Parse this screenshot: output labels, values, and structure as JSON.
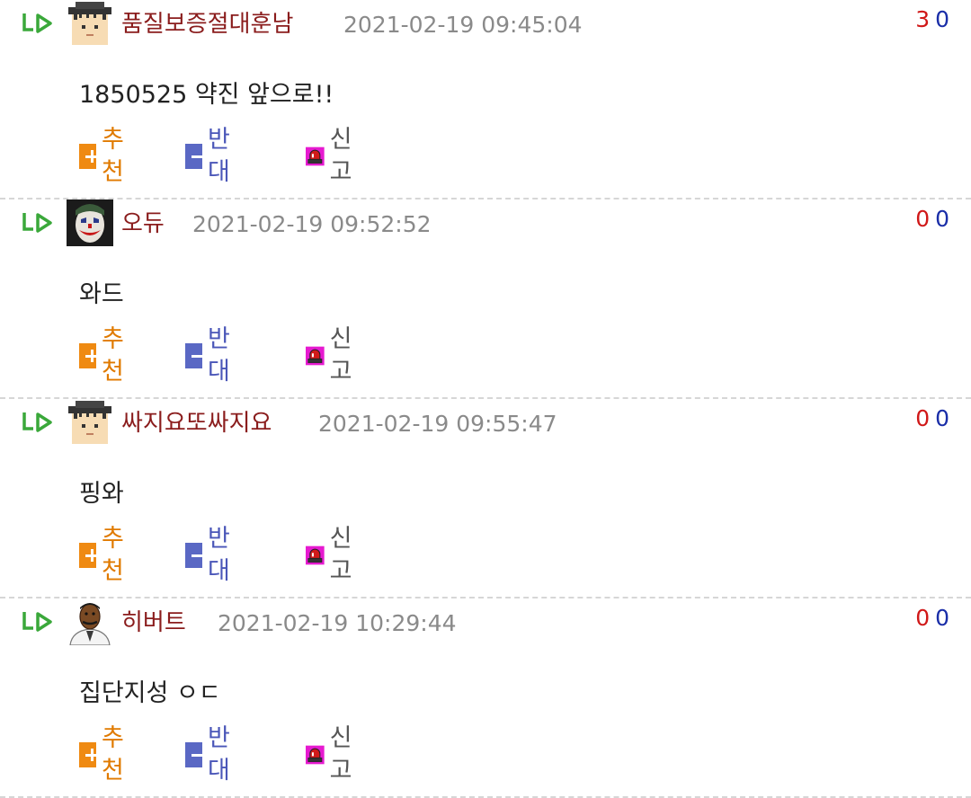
{
  "comments": [
    {
      "avatar": "graduate-cap-avatar",
      "nickname": "품질보증절대훈남",
      "date": "2021-02-19 09:45:04",
      "upvotes": "3",
      "downvotes": "0",
      "text": "1850525 약진 앞으로!!"
    },
    {
      "avatar": "joker-avatar",
      "nickname": "오듀",
      "date": "2021-02-19 09:52:52",
      "upvotes": "0",
      "downvotes": "0",
      "text": "와드"
    },
    {
      "avatar": "graduate-cap-avatar",
      "nickname": "싸지요또싸지요",
      "date": "2021-02-19 09:55:47",
      "upvotes": "0",
      "downvotes": "0",
      "text": "핑와"
    },
    {
      "avatar": "doctor-avatar",
      "nickname": "히버트",
      "date": "2021-02-19 10:29:44",
      "upvotes": "0",
      "downvotes": "0",
      "text": "집단지성 ㅇㄷ"
    }
  ],
  "actions": {
    "recommend": "추천",
    "oppose": "반대",
    "report": "신고"
  },
  "colors": {
    "nickname": "#8a1c1c",
    "date": "#8a8a8a",
    "upvote": "#d01818",
    "downvote": "#1a2ea8",
    "recommend": "#e07a00",
    "oppose": "#4a56b8",
    "reply_arrow": "#3aa83a"
  }
}
